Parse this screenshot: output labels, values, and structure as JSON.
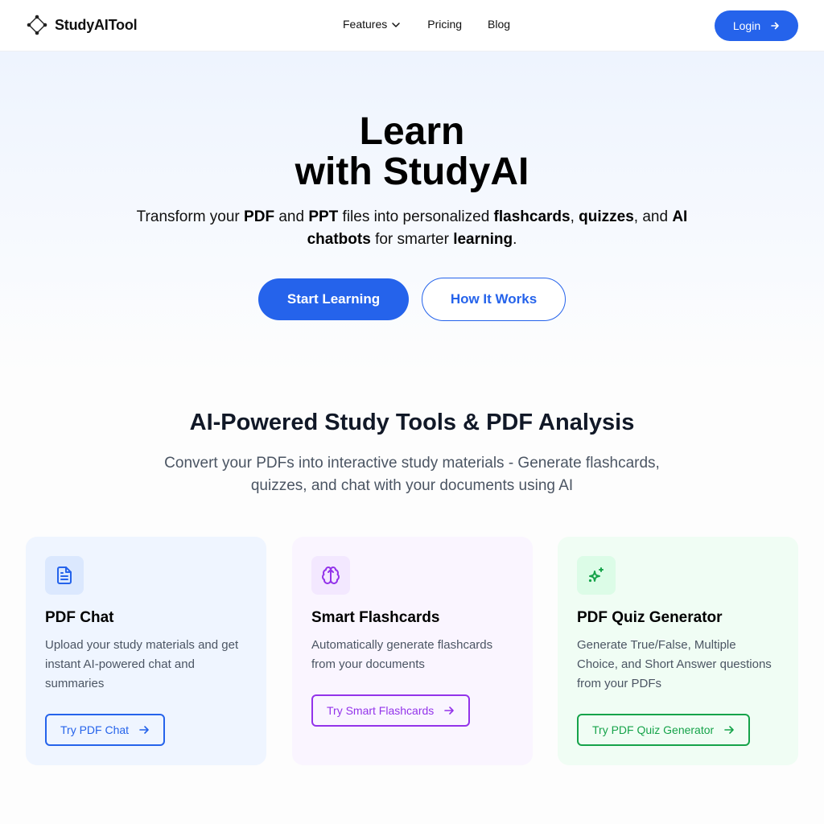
{
  "nav": {
    "brand": "StudyAITool",
    "links": [
      {
        "label": "Features",
        "has_dropdown": true
      },
      {
        "label": "Pricing"
      },
      {
        "label": "Blog"
      }
    ],
    "login_label": "Login"
  },
  "hero": {
    "title_line1": "Learn",
    "title_line2": "with StudyAI",
    "subtitle_parts": [
      {
        "text": "Transform your ",
        "bold": false
      },
      {
        "text": "PDF",
        "bold": true
      },
      {
        "text": " and ",
        "bold": false
      },
      {
        "text": "PPT",
        "bold": true
      },
      {
        "text": " files into personalized ",
        "bold": false
      },
      {
        "text": "flashcards",
        "bold": true
      },
      {
        "text": ", ",
        "bold": false
      },
      {
        "text": "quizzes",
        "bold": true
      },
      {
        "text": ", and ",
        "bold": false
      },
      {
        "text": "AI chatbots",
        "bold": true
      },
      {
        "text": " for smarter ",
        "bold": false
      },
      {
        "text": "learning",
        "bold": true
      },
      {
        "text": ".",
        "bold": false
      }
    ],
    "primary_cta": "Start Learning",
    "secondary_cta": "How It Works"
  },
  "features": {
    "title": "AI-Powered Study Tools & PDF Analysis",
    "subtitle": "Convert your PDFs into interactive study materials - Generate flashcards, quizzes, and chat with your documents using AI",
    "cards": [
      {
        "icon": "file-text-icon",
        "title": "PDF Chat",
        "description": "Upload your study materials and get instant AI-powered chat and summaries",
        "button": "Try PDF Chat",
        "accent": "#2563eb"
      },
      {
        "icon": "brain-icon",
        "title": "Smart Flashcards",
        "description": "Automatically generate flashcards from your documents",
        "button": "Try Smart Flashcards",
        "accent": "#9333ea"
      },
      {
        "icon": "sparkles-icon",
        "title": "PDF Quiz Generator",
        "description": "Generate True/False, Multiple Choice, and Short Answer questions from your PDFs",
        "button": "Try PDF Quiz Generator",
        "accent": "#16a34a"
      }
    ]
  },
  "colors": {
    "primary": "#2563eb",
    "purple": "#9333ea",
    "green": "#16a34a"
  }
}
